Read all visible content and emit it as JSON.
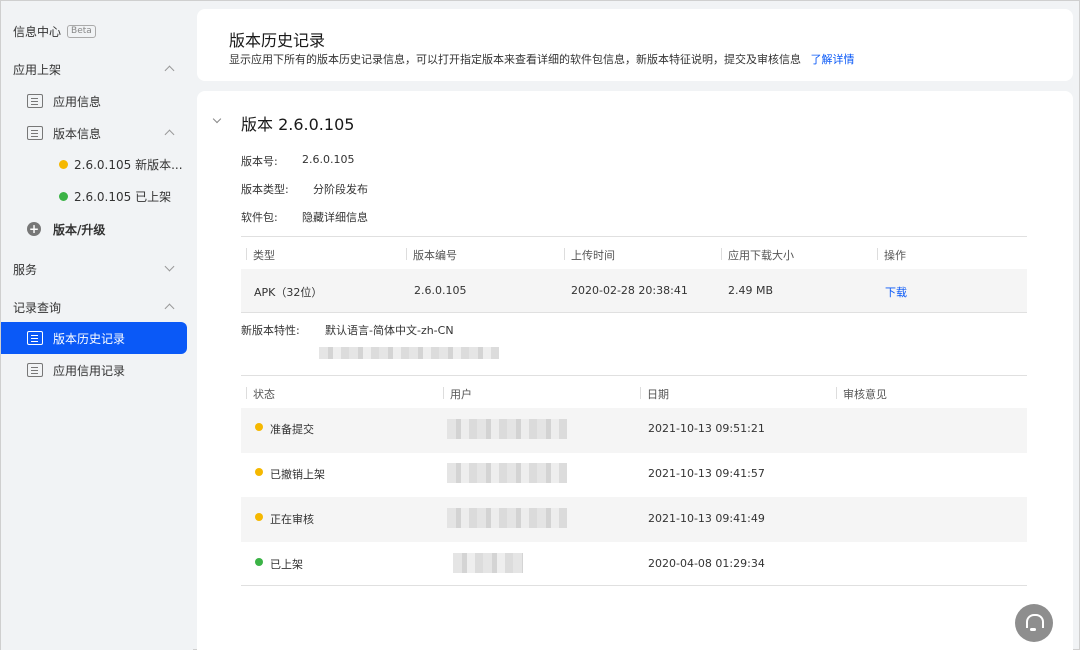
{
  "sidebar": {
    "info_center": "信息中心",
    "beta": "Beta",
    "app_listing": "应用上架",
    "app_info": "应用信息",
    "version_info": "版本信息",
    "version_1": "2.6.0.105 新版本...",
    "version_2": "2.6.0.105 已上架",
    "version_upgrade": "版本/升级",
    "services": "服务",
    "record_query": "记录查询",
    "version_history": "版本历史记录",
    "credit_record": "应用信用记录"
  },
  "header": {
    "title": "版本历史记录",
    "desc": "显示应用下所有的版本历史记录信息，可以打开指定版本来查看详细的软件包信息，新版本特征说明，提交及审核信息",
    "learn_more": "了解详情"
  },
  "version": {
    "title": "版本 2.6.0.105",
    "number_label": "版本号:",
    "number": "2.6.0.105",
    "type_label": "版本类型:",
    "type": "分阶段发布",
    "package_label": "软件包:",
    "package_link": "隐藏详细信息",
    "features_label": "新版本特性:",
    "features_value": "默认语言-简体中文-zh-CN"
  },
  "package_table": {
    "headers": [
      "类型",
      "版本编号",
      "上传时间",
      "应用下载大小",
      "操作"
    ],
    "row": [
      "APK（32位）",
      "2.6.0.105",
      "2020-02-28 20:38:41",
      "2.49 MB",
      "下载"
    ]
  },
  "review_table": {
    "headers": [
      "状态",
      "用户",
      "日期",
      "审核意见"
    ],
    "rows": [
      {
        "status": "准备提交",
        "color": "#f5b800",
        "date": "2021-10-13 09:51:21"
      },
      {
        "status": "已撤销上架",
        "color": "#f5b800",
        "date": "2021-10-13 09:41:57"
      },
      {
        "status": "正在审核",
        "color": "#f5b800",
        "date": "2021-10-13 09:41:49"
      },
      {
        "status": "已上架",
        "color": "#3bb346",
        "date": "2020-04-08 01:29:34"
      }
    ]
  }
}
